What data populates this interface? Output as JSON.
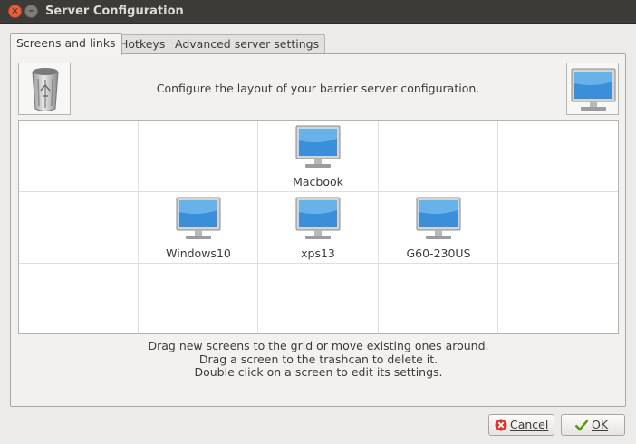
{
  "window": {
    "title": "Server Configuration"
  },
  "tabs": [
    {
      "label": "Screens and links",
      "active": true
    },
    {
      "label": "Hotkeys",
      "active": false
    },
    {
      "label": "Advanced server settings",
      "active": false
    }
  ],
  "header": {
    "text": "Configure the layout of your barrier server configuration."
  },
  "grid": {
    "rows": 3,
    "cols": 5,
    "screens": [
      {
        "name": "Macbook",
        "row": 0,
        "col": 2
      },
      {
        "name": "Windows10",
        "row": 1,
        "col": 1
      },
      {
        "name": "xps13",
        "row": 1,
        "col": 2
      },
      {
        "name": "G60-230US",
        "row": 1,
        "col": 3
      }
    ]
  },
  "help": {
    "line1": "Drag new screens to the grid or move existing ones around.",
    "line2": "Drag a screen to the trashcan to delete it.",
    "line3": "Double click on a screen to edit its settings."
  },
  "buttons": {
    "cancel": "Cancel",
    "ok": "OK"
  },
  "colors": {
    "titlebar": "#3c3b37",
    "close": "#e8603b",
    "screen_blue": "#3a8fd8"
  }
}
